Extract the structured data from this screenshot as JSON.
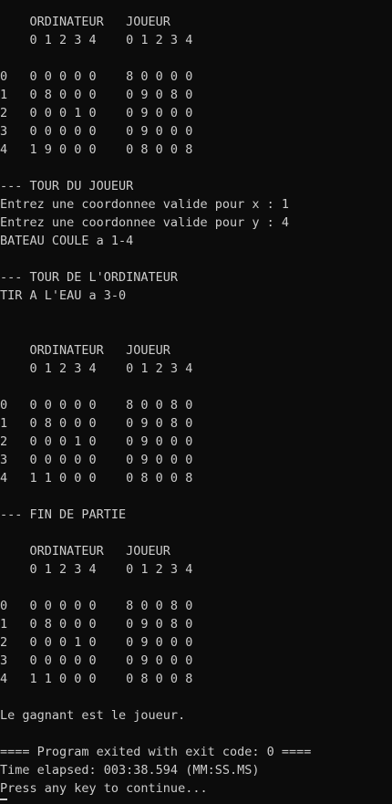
{
  "console": {
    "lines": [
      "    ORDINATEUR   JOUEUR",
      "    0 1 2 3 4    0 1 2 3 4",
      "",
      "0   0 0 0 0 0    8 0 0 0 0",
      "1   0 8 0 0 0    0 9 0 8 0",
      "2   0 0 0 1 0    0 9 0 0 0",
      "3   0 0 0 0 0    0 9 0 0 0",
      "4   1 9 0 0 0    0 8 0 0 8",
      "",
      "--- TOUR DU JOUEUR",
      "Entrez une coordonnee valide pour x : 1",
      "Entrez une coordonnee valide pour y : 4",
      "BATEAU COULE a 1-4",
      "",
      "--- TOUR DE L'ORDINATEUR",
      "TIR A L'EAU a 3-0",
      "",
      "",
      "    ORDINATEUR   JOUEUR",
      "    0 1 2 3 4    0 1 2 3 4",
      "",
      "0   0 0 0 0 0    8 0 0 8 0",
      "1   0 8 0 0 0    0 9 0 8 0",
      "2   0 0 0 1 0    0 9 0 0 0",
      "3   0 0 0 0 0    0 9 0 0 0",
      "4   1 1 0 0 0    0 8 0 0 8",
      "",
      "--- FIN DE PARTIE",
      "",
      "    ORDINATEUR   JOUEUR",
      "    0 1 2 3 4    0 1 2 3 4",
      "",
      "0   0 0 0 0 0    8 0 0 8 0",
      "1   0 8 0 0 0    0 9 0 8 0",
      "2   0 0 0 1 0    0 9 0 0 0",
      "3   0 0 0 0 0    0 9 0 0 0",
      "4   1 1 0 0 0    0 8 0 0 8",
      "",
      "Le gagnant est le joueur.",
      "",
      "==== Program exited with exit code: 0 ====",
      "Time elapsed: 003:38.594 (MM:SS.MS)",
      "Press any key to continue..."
    ]
  },
  "colors": {
    "background": "#0c0c0c",
    "text": "#cccccc"
  }
}
